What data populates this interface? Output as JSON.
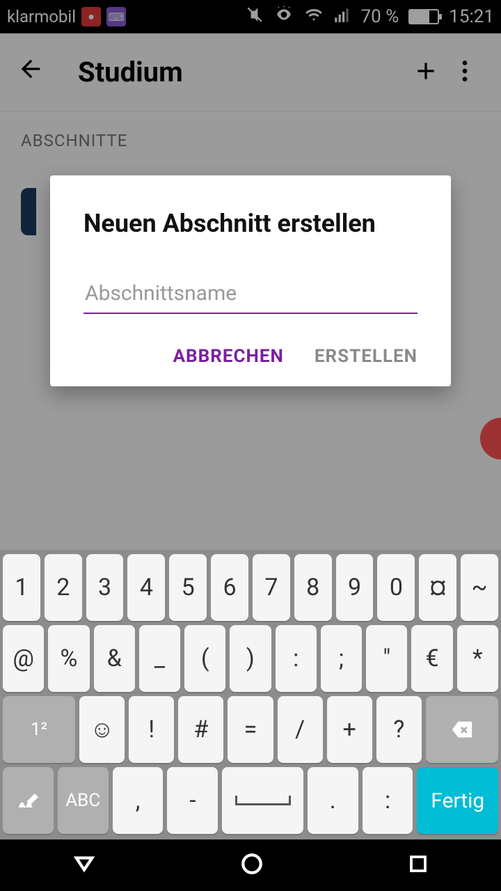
{
  "status": {
    "carrier": "klarmobil",
    "battery_pct": "70 %",
    "clock": "15:21"
  },
  "appbar": {
    "title": "Studium"
  },
  "content": {
    "section_label": "ABSCHNITTE"
  },
  "dialog": {
    "title": "Neuen Abschnitt erstellen",
    "placeholder": "Abschnittsname",
    "cancel": "ABBRECHEN",
    "create": "ERSTELLEN"
  },
  "keyboard": {
    "row1": [
      "1",
      "2",
      "3",
      "4",
      "5",
      "6",
      "7",
      "8",
      "9",
      "0",
      "¤",
      "~"
    ],
    "row2": [
      "@",
      "%",
      "&",
      "_",
      "(",
      ")",
      ":",
      ";",
      "\"",
      "€",
      "*"
    ],
    "row3_mid": [
      "☺",
      "!",
      "#",
      "=",
      "/",
      "+",
      "?"
    ],
    "row4_mid": [
      ",",
      "-",
      "SPACE",
      ".",
      ":"
    ],
    "mode": "ABC",
    "done": "Fertig",
    "shift": "1²"
  }
}
